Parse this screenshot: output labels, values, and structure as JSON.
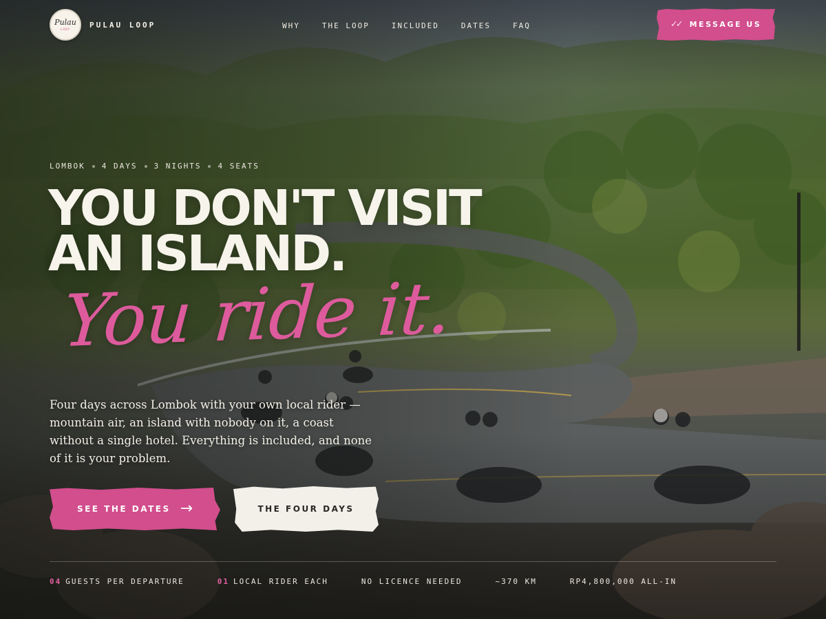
{
  "brand": {
    "logo_script": "Pulau",
    "logo_small": "LOOP",
    "name": "PULAU LOOP"
  },
  "nav": {
    "links": [
      "WHY",
      "THE LOOP",
      "INCLUDED",
      "DATES",
      "FAQ"
    ],
    "message_button": {
      "label": "MESSAGE US",
      "icon": "double-check-icon"
    }
  },
  "hero": {
    "meta": [
      "LOMBOK",
      "4 DAYS",
      "3 NIGHTS",
      "4 SEATS"
    ],
    "headline": [
      "YOU DON'T VISIT",
      "AN ISLAND."
    ],
    "script_line": "You ride it.",
    "lede": "Four days across Lombok with your own local rider — mountain air, an island with nobody on it, a coast without a single hotel. Everything is included, and none of it is your problem.",
    "cta_primary": {
      "label": "SEE THE DATES",
      "arrow": "→"
    },
    "cta_secondary": {
      "label": "THE FOUR DAYS"
    }
  },
  "stats": [
    {
      "num": "04",
      "label": "GUESTS PER DEPARTURE"
    },
    {
      "num": "01",
      "label": "LOCAL RIDER EACH"
    },
    {
      "num": "",
      "label": "NO LICENCE NEEDED"
    },
    {
      "num": "",
      "label": "~370 KM"
    },
    {
      "num": "",
      "label": "RP4,800,000 ALL-IN"
    }
  ],
  "colors": {
    "accent": "#d24e8d",
    "script": "#dd5b9c",
    "cream": "#f3f0ea"
  }
}
